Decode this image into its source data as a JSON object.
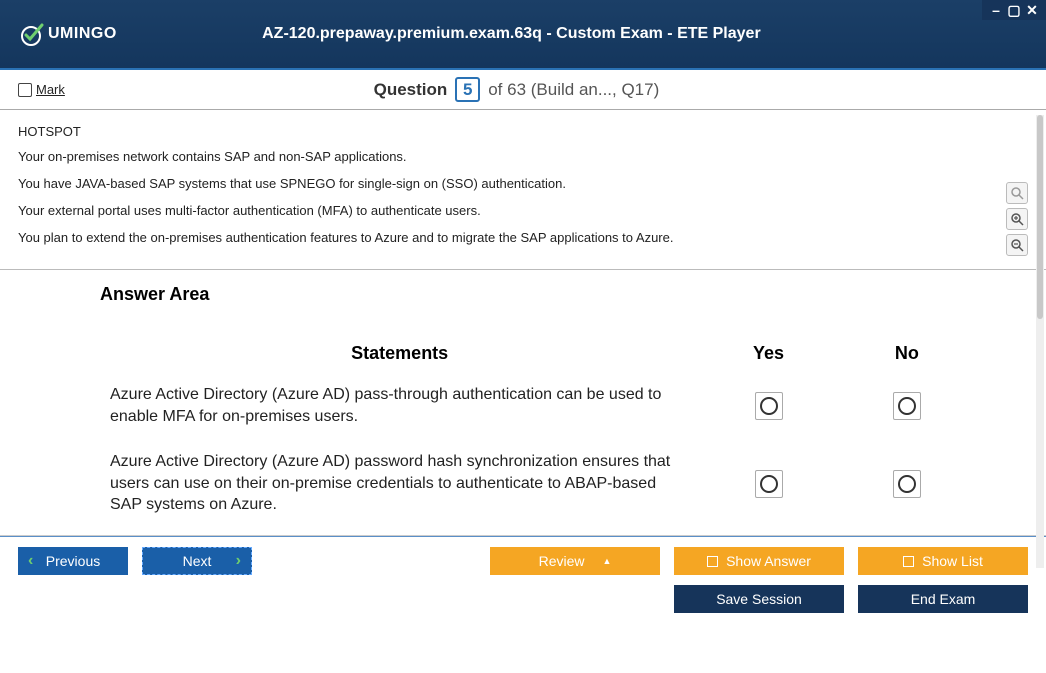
{
  "window": {
    "minimize": "–",
    "maximize": "▢",
    "close": "✕"
  },
  "header": {
    "logo_text": "UMINGO",
    "title": "AZ-120.prepaway.premium.exam.63q - Custom Exam - ETE Player"
  },
  "subheader": {
    "mark_label": "Mark",
    "question_word": "Question",
    "question_number": "5",
    "of_text": "of 63 (Build an..., Q17)"
  },
  "question": {
    "hotspot_label": "HOTSPOT",
    "lines": [
      "Your on-premises network contains SAP and non-SAP applications.",
      "You have JAVA-based SAP systems that use SPNEGO for single-sign on (SSO) authentication.",
      "Your external portal uses multi-factor authentication (MFA) to authenticate users.",
      "You plan to extend the on-premises authentication features to Azure and to migrate the SAP applications to Azure."
    ]
  },
  "answer_area": {
    "heading": "Answer Area",
    "col_statements": "Statements",
    "col_yes": "Yes",
    "col_no": "No",
    "rows": [
      "Azure Active Directory (Azure AD) pass-through authentication can be used to enable MFA for on-premises users.",
      "Azure Active Directory (Azure AD) password hash synchronization ensures that users can use on their on-premise credentials to authenticate to ABAP-based SAP systems on Azure."
    ]
  },
  "footer": {
    "previous": "Previous",
    "next": "Next",
    "review": "Review",
    "show_answer": "Show Answer",
    "show_list": "Show List",
    "save_session": "Save Session",
    "end_exam": "End Exam"
  }
}
